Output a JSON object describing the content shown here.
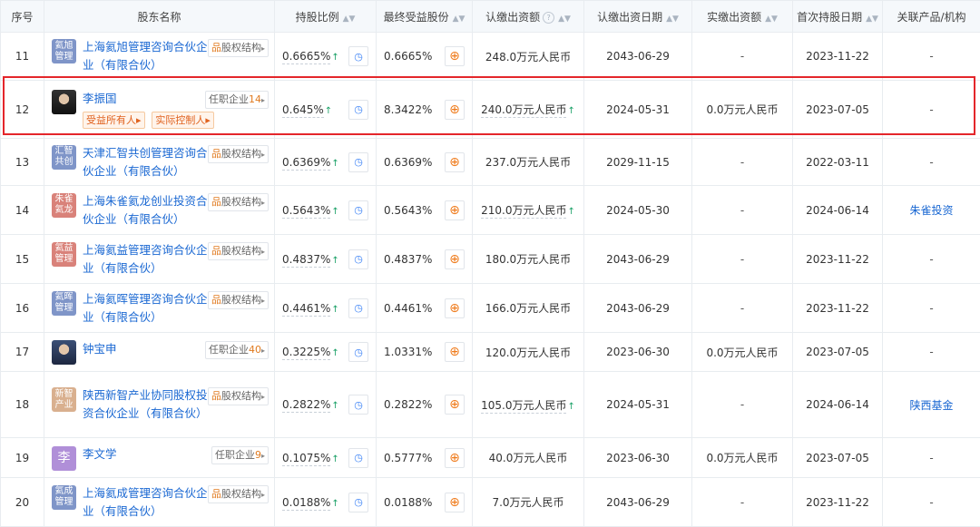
{
  "headers": {
    "index": "序号",
    "name": "股东名称",
    "ratio": "持股比例",
    "final": "最终受益股份",
    "capital": "认缴出资额",
    "cap_date": "认缴出资日期",
    "paid": "实缴出资额",
    "first_date": "首次持股日期",
    "related": "关联产品/机构"
  },
  "labels": {
    "equity": "股权结构",
    "serve": "任职企业",
    "beneficial": "受益所有人",
    "controller": "实际控制人"
  },
  "rows": [
    {
      "index": "11",
      "logo": "氦旭\n管理",
      "name": "上海氦旭管理咨询合伙企业（有限合伙）",
      "ratio": "0.6665%",
      "final": "0.6665%",
      "capital": "248.0万元人民币",
      "cap_date": "2043-06-29",
      "paid": "-",
      "first_date": "2023-11-22",
      "related": "-"
    },
    {
      "index": "12",
      "name": "李振国",
      "serve_count": "14",
      "ratio": "0.645%",
      "final": "8.3422%",
      "capital": "240.0万元人民币",
      "cap_date": "2024-05-31",
      "paid": "0.0万元人民币",
      "first_date": "2023-07-05",
      "related": "-"
    },
    {
      "index": "13",
      "logo": "汇智\n共创",
      "name": "天津汇智共创管理咨询合伙企业（有限合伙）",
      "ratio": "0.6369%",
      "final": "0.6369%",
      "capital": "237.0万元人民币",
      "cap_date": "2029-11-15",
      "paid": "-",
      "first_date": "2022-03-11",
      "related": "-"
    },
    {
      "index": "14",
      "logo": "朱雀\n氦龙",
      "name": "上海朱雀氦龙创业投资合伙企业（有限合伙）",
      "ratio": "0.5643%",
      "final": "0.5643%",
      "capital": "210.0万元人民币",
      "cap_date": "2024-05-30",
      "paid": "-",
      "first_date": "2024-06-14",
      "related": "朱雀投资"
    },
    {
      "index": "15",
      "logo": "氦益\n管理",
      "name": "上海氦益管理咨询合伙企业（有限合伙）",
      "ratio": "0.4837%",
      "final": "0.4837%",
      "capital": "180.0万元人民币",
      "cap_date": "2043-06-29",
      "paid": "-",
      "first_date": "2023-11-22",
      "related": "-"
    },
    {
      "index": "16",
      "logo": "氦晖\n管理",
      "name": "上海氦晖管理咨询合伙企业（有限合伙）",
      "ratio": "0.4461%",
      "final": "0.4461%",
      "capital": "166.0万元人民币",
      "cap_date": "2043-06-29",
      "paid": "-",
      "first_date": "2023-11-22",
      "related": "-"
    },
    {
      "index": "17",
      "name": "钟宝申",
      "serve_count": "40",
      "ratio": "0.3225%",
      "final": "1.0331%",
      "capital": "120.0万元人民币",
      "cap_date": "2023-06-30",
      "paid": "0.0万元人民币",
      "first_date": "2023-07-05",
      "related": "-"
    },
    {
      "index": "18",
      "logo": "新智\n产业",
      "name": "陕西新智产业协同股权投资合伙企业（有限合伙）",
      "ratio": "0.2822%",
      "final": "0.2822%",
      "capital": "105.0万元人民币",
      "cap_date": "2024-05-31",
      "paid": "-",
      "first_date": "2024-06-14",
      "related": "陕西基金"
    },
    {
      "index": "19",
      "logo": "李",
      "name": "李文学",
      "serve_count": "9",
      "ratio": "0.1075%",
      "final": "0.5777%",
      "capital": "40.0万元人民币",
      "cap_date": "2023-06-30",
      "paid": "0.0万元人民币",
      "first_date": "2023-07-05",
      "related": "-"
    },
    {
      "index": "20",
      "logo": "氦成\n管理",
      "name": "上海氦成管理咨询合伙企业（有限合伙）",
      "ratio": "0.0188%",
      "final": "0.0188%",
      "capital": "7.0万元人民币",
      "cap_date": "2043-06-29",
      "paid": "-",
      "first_date": "2023-11-22",
      "related": "-"
    }
  ]
}
